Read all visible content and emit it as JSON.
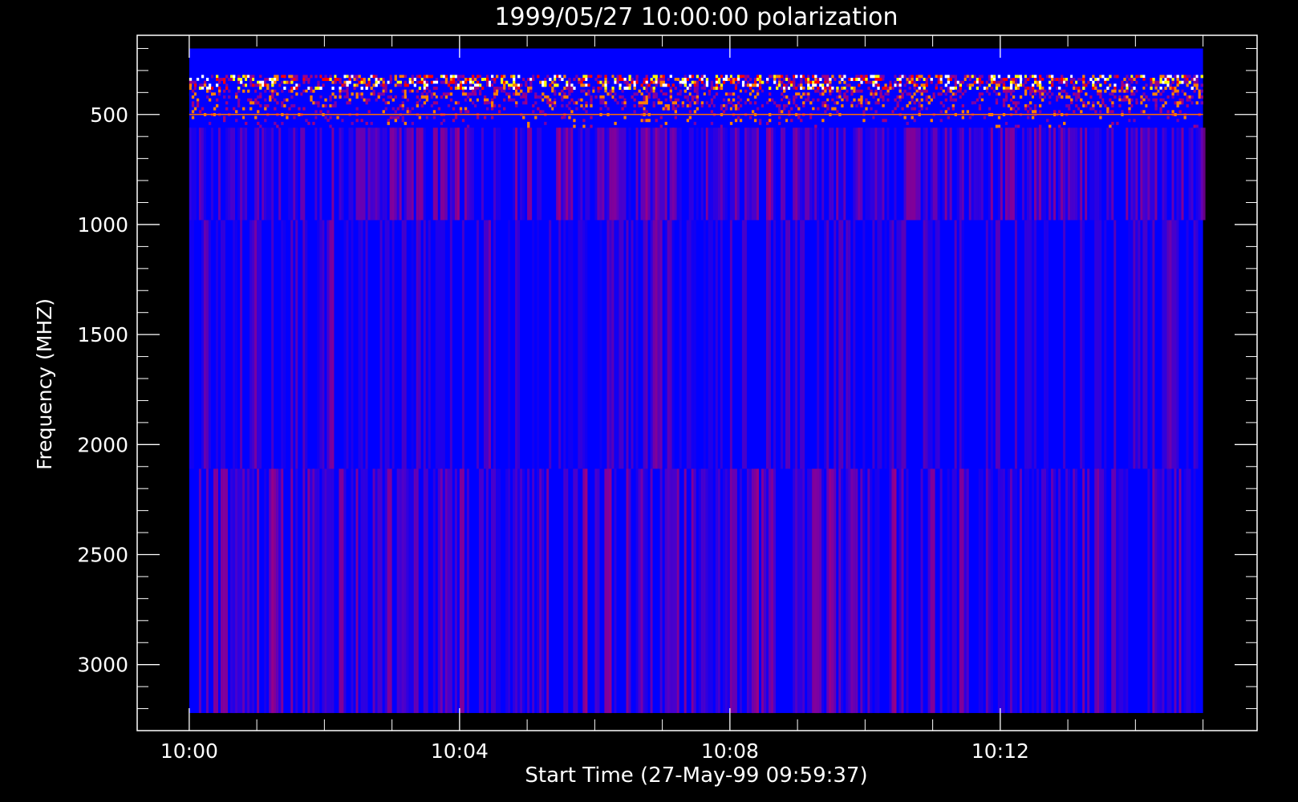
{
  "chart_data": {
    "type": "heatmap",
    "title": "1999/05/27 10:00:00 polarization",
    "xlabel": "Start Time (27-May-99 09:59:37)",
    "ylabel": "Frequency (MHZ)",
    "x_ticks": [
      "10:00",
      "10:04",
      "10:08",
      "10:12"
    ],
    "y_ticks": [
      500,
      1000,
      1500,
      2000,
      2500,
      3000
    ],
    "y_reversed": true,
    "ylim": [
      3300,
      140
    ],
    "xlim_minutes": [
      -0.77,
      15.8
    ],
    "data_x_range_minutes": [
      0,
      15
    ],
    "data_y_range_mhz": [
      200,
      3220
    ],
    "bands": [
      {
        "from_mhz": 200,
        "to_mhz": 320,
        "level": "uniform"
      },
      {
        "from_mhz": 320,
        "to_mhz": 560,
        "level": "noisy"
      },
      {
        "from_mhz": 560,
        "to_mhz": 980,
        "level": "striped"
      },
      {
        "from_mhz": 980,
        "to_mhz": 2110,
        "level": "faint"
      },
      {
        "from_mhz": 2110,
        "to_mhz": 3220,
        "level": "striped"
      }
    ],
    "colormap": [
      "#0000ff",
      "#7a00a8",
      "#ff0000",
      "#ffff00"
    ],
    "grid": false
  },
  "colors": {
    "background": "#000000",
    "foreground": "#ffffff",
    "base": "#0000ff"
  }
}
